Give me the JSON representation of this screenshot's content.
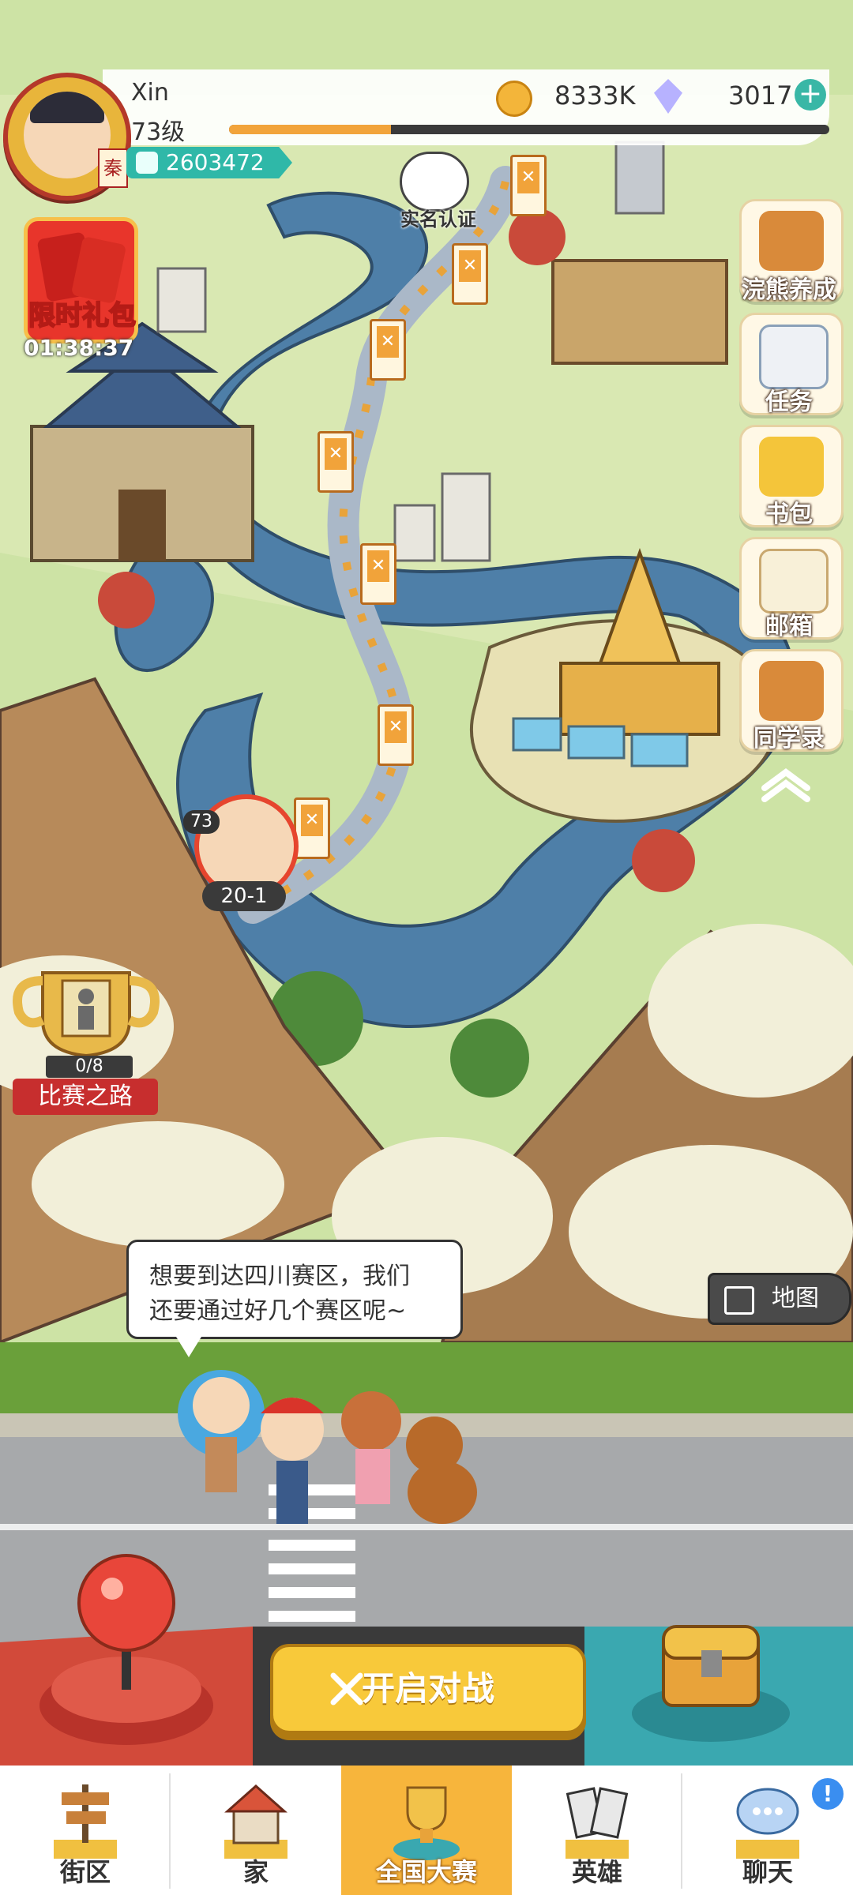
{
  "player": {
    "name": "Xin",
    "level": "73级",
    "power": "2603472",
    "xp_progress": 0.27
  },
  "currency": {
    "coins": "8333K",
    "gems": "3017"
  },
  "widgets": {
    "gift_label": "限时礼包",
    "gift_timer": "01:38:37",
    "trophy_progress": "0/8",
    "trophy_label": "比赛之路",
    "realname_label": "实名认证"
  },
  "right_menu": [
    {
      "label": "浣熊养成",
      "icon": "raccoon-icon"
    },
    {
      "label": "任务",
      "icon": "clipboard-icon"
    },
    {
      "label": "书包",
      "icon": "backpack-icon"
    },
    {
      "label": "邮箱",
      "icon": "envelope-icon"
    },
    {
      "label": "同学录",
      "icon": "raccoon-book-icon"
    }
  ],
  "map_marker": {
    "level": "73",
    "stage": "20-1"
  },
  "dialogue": {
    "line1": "想要到达四川赛区，我们",
    "line2": "还要通过好几个赛区呢~"
  },
  "map_button": "地图",
  "battle_button": "开启对战",
  "nav": {
    "items": [
      {
        "label": "街区",
        "icon": "signpost-icon"
      },
      {
        "label": "家",
        "icon": "house-icon"
      },
      {
        "label": "全国大赛",
        "icon": "trophy-icon"
      },
      {
        "label": "英雄",
        "icon": "cards-icon"
      },
      {
        "label": "聊天",
        "icon": "chat-bubble-icon"
      }
    ],
    "active_index": 2,
    "chat_notice": "!"
  },
  "colors": {
    "accent": "#f7b53c",
    "teal": "#2fb8a8",
    "red": "#e8352b",
    "river": "#4e7fa8"
  }
}
